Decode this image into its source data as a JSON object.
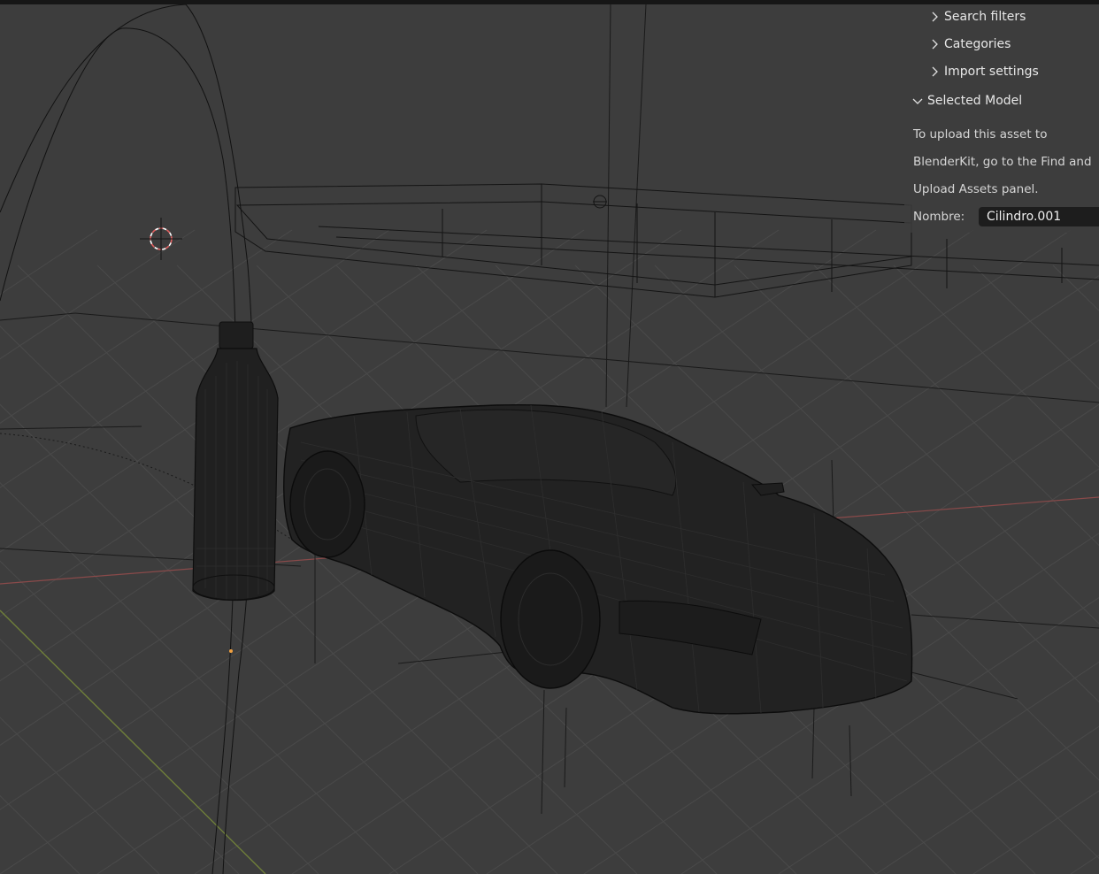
{
  "viewport": {
    "colors": {
      "background": "#3d3d3d",
      "grid": "#4a4a4a",
      "axis_x": "#8a4a4a",
      "axis_y": "#6f7f3a",
      "wire": "#141414",
      "cursor_red": "#e06060",
      "origin": "#f0a040"
    }
  },
  "panel": {
    "sections": [
      {
        "label": "Search filters",
        "expanded": false
      },
      {
        "label": "Categories",
        "expanded": false
      },
      {
        "label": "Import settings",
        "expanded": false
      },
      {
        "label": "Selected Model",
        "expanded": true
      }
    ],
    "upload_text": [
      "To upload this asset to",
      "BlenderKit, go to the Find and",
      "Upload Assets panel."
    ],
    "name_label": "Nombre:",
    "name_value": "Cilindro.001"
  }
}
